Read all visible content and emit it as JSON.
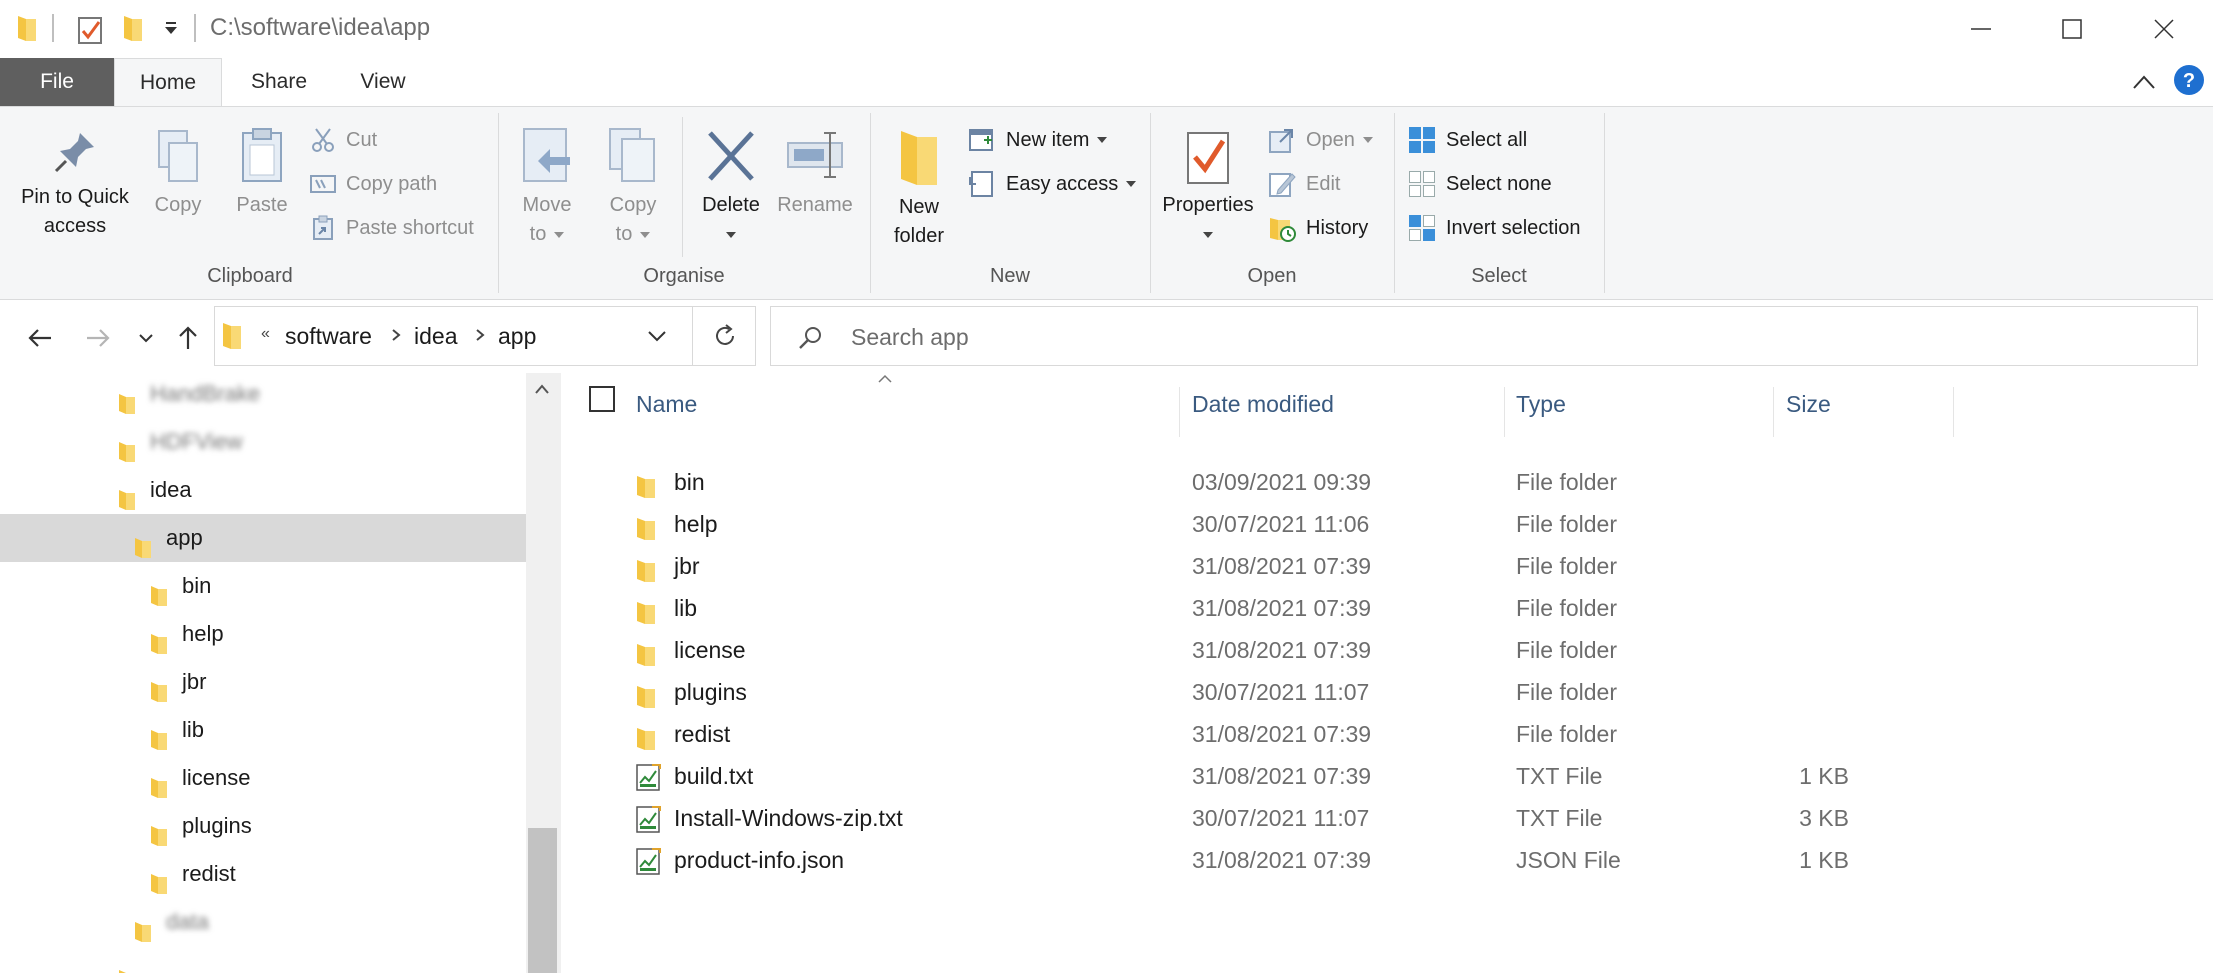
{
  "window": {
    "title_path": "C:\\software\\idea\\app"
  },
  "ribbon_tabs": [
    "File",
    "Home",
    "Share",
    "View"
  ],
  "ribbon": {
    "clipboard": {
      "label": "Clipboard",
      "pin_line1": "Pin to Quick",
      "pin_line2": "access",
      "copy": "Copy",
      "paste": "Paste",
      "cut": "Cut",
      "copy_path": "Copy path",
      "paste_shortcut": "Paste shortcut"
    },
    "organise": {
      "label": "Organise",
      "move_to_line1": "Move",
      "move_to_line2": "to",
      "copy_to_line1": "Copy",
      "copy_to_line2": "to",
      "delete": "Delete",
      "rename": "Rename"
    },
    "new": {
      "label": "New",
      "new_folder_line1": "New",
      "new_folder_line2": "folder",
      "new_item": "New item",
      "easy_access": "Easy access"
    },
    "open": {
      "label": "Open",
      "properties": "Properties",
      "open": "Open",
      "edit": "Edit",
      "history": "History"
    },
    "select": {
      "label": "Select",
      "select_all": "Select all",
      "select_none": "Select none",
      "invert_selection": "Invert selection"
    }
  },
  "address": {
    "overflow": "«",
    "crumbs": [
      "software",
      "idea",
      "app"
    ],
    "search_placeholder": "Search app"
  },
  "nav_pane": {
    "items": [
      {
        "label": "HandBrake",
        "blurred": true
      },
      {
        "label": "HDFView",
        "blurred": true
      },
      {
        "label": "idea",
        "blurred": false
      },
      {
        "label": "app",
        "blurred": false,
        "selected": true
      },
      {
        "label": "bin",
        "blurred": false
      },
      {
        "label": "help",
        "blurred": false
      },
      {
        "label": "jbr",
        "blurred": false
      },
      {
        "label": "lib",
        "blurred": false
      },
      {
        "label": "license",
        "blurred": false
      },
      {
        "label": "plugins",
        "blurred": false
      },
      {
        "label": "redist",
        "blurred": false
      },
      {
        "label": "data",
        "blurred": true
      }
    ]
  },
  "columns": {
    "name": "Name",
    "date_modified": "Date modified",
    "type": "Type",
    "size": "Size"
  },
  "files": [
    {
      "name": "bin",
      "date": "03/09/2021 09:39",
      "type": "File folder",
      "size": "",
      "icon": "folder-icon"
    },
    {
      "name": "help",
      "date": "30/07/2021 11:06",
      "type": "File folder",
      "size": "",
      "icon": "folder-icon"
    },
    {
      "name": "jbr",
      "date": "31/08/2021 07:39",
      "type": "File folder",
      "size": "",
      "icon": "folder-icon"
    },
    {
      "name": "lib",
      "date": "31/08/2021 07:39",
      "type": "File folder",
      "size": "",
      "icon": "folder-icon"
    },
    {
      "name": "license",
      "date": "31/08/2021 07:39",
      "type": "File folder",
      "size": "",
      "icon": "folder-icon"
    },
    {
      "name": "plugins",
      "date": "30/07/2021 11:07",
      "type": "File folder",
      "size": "",
      "icon": "folder-icon"
    },
    {
      "name": "redist",
      "date": "31/08/2021 07:39",
      "type": "File folder",
      "size": "",
      "icon": "folder-icon"
    },
    {
      "name": "build.txt",
      "date": "31/08/2021 07:39",
      "type": "TXT File",
      "size": "1 KB",
      "icon": "text-file-icon"
    },
    {
      "name": "Install-Windows-zip.txt",
      "date": "30/07/2021 11:07",
      "type": "TXT File",
      "size": "3 KB",
      "icon": "text-file-icon"
    },
    {
      "name": "product-info.json",
      "date": "31/08/2021 07:39",
      "type": "JSON File",
      "size": "1 KB",
      "icon": "text-file-icon"
    }
  ],
  "colors": {
    "folder": "#f4c542",
    "accent_blue": "#1e6fd0",
    "file_tab": "#5f5f5f",
    "selected_row": "#d9d9d9"
  }
}
